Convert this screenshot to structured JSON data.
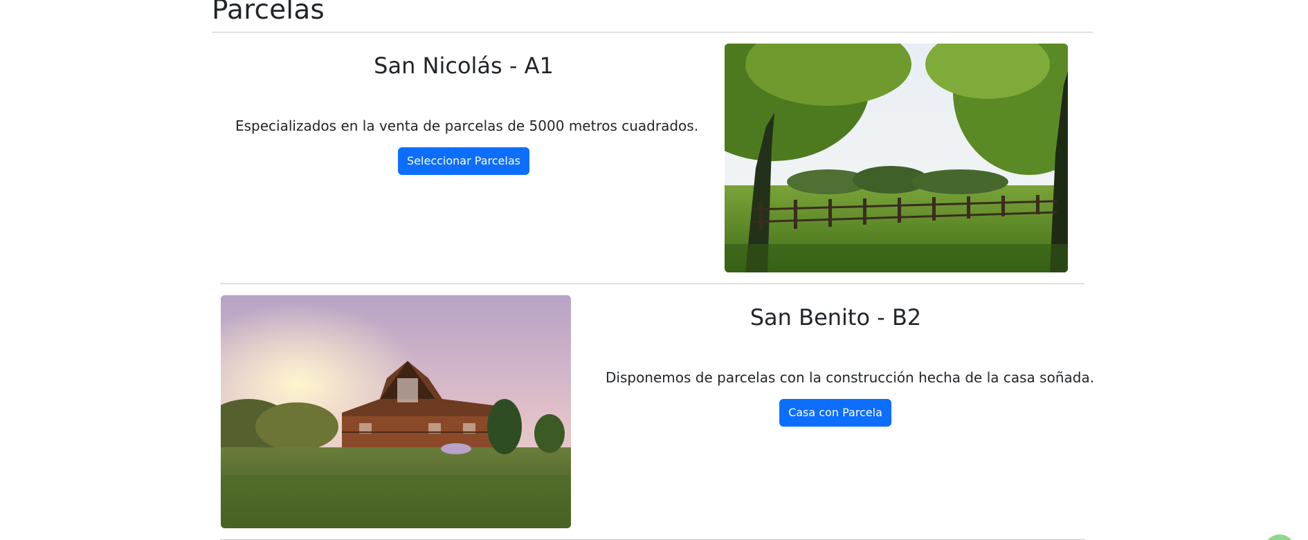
{
  "page": {
    "title": "Parcelas"
  },
  "listings": [
    {
      "name": "San Nicolás - A1",
      "description": "Especializados en la venta de parcelas de 5000 metros cuadrados.",
      "button_label": "Seleccionar Parcelas",
      "image_subject": "field-with-trees-and-fence"
    },
    {
      "name": "San Benito - B2",
      "description": "Disponemos de parcelas con la construcción hecha de la casa soñada.",
      "button_label": "Casa con Parcela",
      "image_subject": "log-house-on-lawn-at-sunset"
    }
  ],
  "colors": {
    "primary_button": "#0d6efd",
    "text": "#212529",
    "divider": "#c9c9c9",
    "floating_button": "#8fd98a"
  }
}
